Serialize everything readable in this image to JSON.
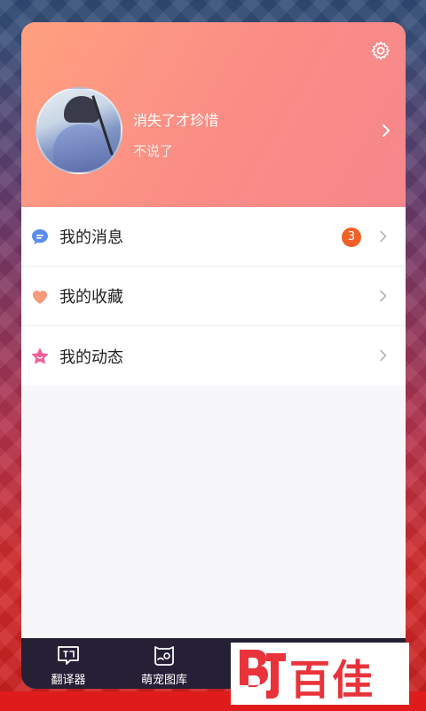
{
  "profile": {
    "username": "消失了才珍惜",
    "signature": "不说了"
  },
  "menu": {
    "items": [
      {
        "label": "我的消息",
        "icon": "message-icon",
        "badge": "3"
      },
      {
        "label": "我的收藏",
        "icon": "heart-icon"
      },
      {
        "label": "我的动态",
        "icon": "star-icon"
      }
    ]
  },
  "tabbar": {
    "tabs": [
      {
        "label": "翻译器",
        "icon": "translate-icon"
      },
      {
        "label": "萌宠图库",
        "icon": "pet-gallery-icon"
      }
    ]
  },
  "watermark": {
    "text": "百佳"
  },
  "colors": {
    "accent": "#f06128",
    "header_from": "#ffa07f",
    "header_to": "#f6878c",
    "tabbar": "#262037"
  }
}
